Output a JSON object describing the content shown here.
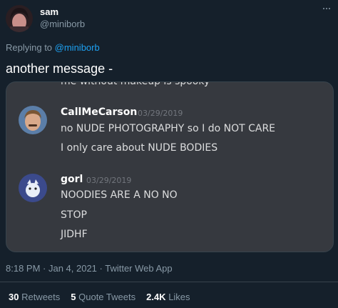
{
  "author": {
    "display_name": "sam",
    "handle": "@miniborb"
  },
  "reply": {
    "prefix": "Replying to ",
    "handle": "@miniborb"
  },
  "tweet": {
    "text": "another message -"
  },
  "media": {
    "cut_off_line": "me without makeup is spooky",
    "messages": [
      {
        "author": "CallMeCarson",
        "timestamp": "03/29/2019",
        "lines": [
          "no NUDE PHOTOGRAPHY so I do NOT CARE",
          "I only care about NUDE BODIES"
        ]
      },
      {
        "author": "gorl",
        "timestamp": "03/29/2019",
        "lines": [
          "NOODIES ARE A  NO NO",
          "STOP",
          "JIDHF"
        ]
      }
    ]
  },
  "meta": {
    "time": "8:18 PM · Jan 4, 2021 · Twitter Web App"
  },
  "stats": {
    "retweets_count": "30",
    "retweets_label": " Retweets",
    "quotes_count": "5",
    "quotes_label": " Quote Tweets",
    "likes_count": "2.4K",
    "likes_label": " Likes"
  },
  "colors": {
    "background": "#15202b",
    "link": "#1da1f2",
    "muted": "#8899a6",
    "discord_bg": "#36393f"
  }
}
